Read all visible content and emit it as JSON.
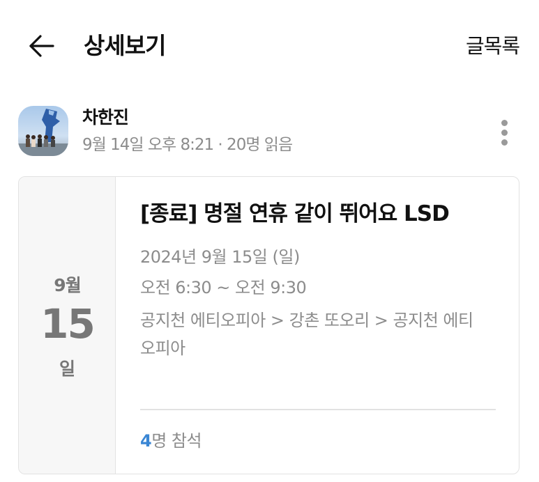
{
  "header": {
    "back_icon": "arrow-left-icon",
    "title": "상세보기",
    "list_label": "글목록"
  },
  "author": {
    "avatar_icon": "profile-photo",
    "name": "차한진",
    "meta": "9월 14일 오후 8:21 · 20명 읽음",
    "more_icon": "more-vertical-icon"
  },
  "event": {
    "month": "9월",
    "day": "15",
    "day_suffix": "일",
    "title": "[종료] 명절 연휴 같이 뛰어요 LSD",
    "date": "2024년 9월 15일 (일)",
    "time": "오전 6:30 ~ 오전 9:30",
    "route": "공지천 에티오피아 > 강촌 또오리 > 공지천 에티오피아",
    "attendee_count": "4",
    "attendee_suffix": "명 참석"
  },
  "colors": {
    "accent": "#3a86d4",
    "muted_text": "#8c8c8c",
    "date_panel_bg": "#f7f7f7",
    "border": "#e2e2e2"
  }
}
